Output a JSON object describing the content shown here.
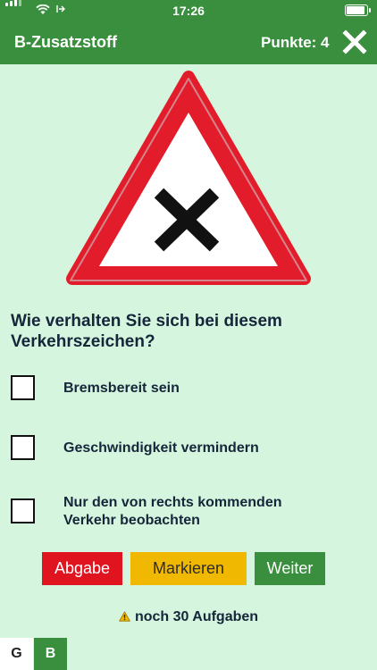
{
  "status_bar": {
    "time": "17:26"
  },
  "header": {
    "title": "B-Zusatzstoff",
    "points": "Punkte: 4",
    "close_icon": "close-icon"
  },
  "question": {
    "text": "Wie verhalten Sie sich bei diesem Verkehrszeichen?",
    "sign": "warning-triangle-crossroads-icon",
    "answers": [
      {
        "label": "Bremsbereit sein",
        "checked": false
      },
      {
        "label": "Geschwindigkeit vermindern",
        "checked": false
      },
      {
        "label": "Nur den von rechts kommenden Verkehr beobachten",
        "checked": false
      }
    ]
  },
  "actions": {
    "submit": "Abgabe",
    "mark": "Markieren",
    "next": "Weiter"
  },
  "footer": {
    "remaining": "noch 30 Aufgaben",
    "tabs": [
      "G",
      "B"
    ],
    "active_tab": "B"
  },
  "colors": {
    "primary": "#3a8f3e",
    "background": "#d5f5de",
    "submit": "#e0141f",
    "mark": "#f0b800",
    "sign_red": "#e21c2a"
  }
}
